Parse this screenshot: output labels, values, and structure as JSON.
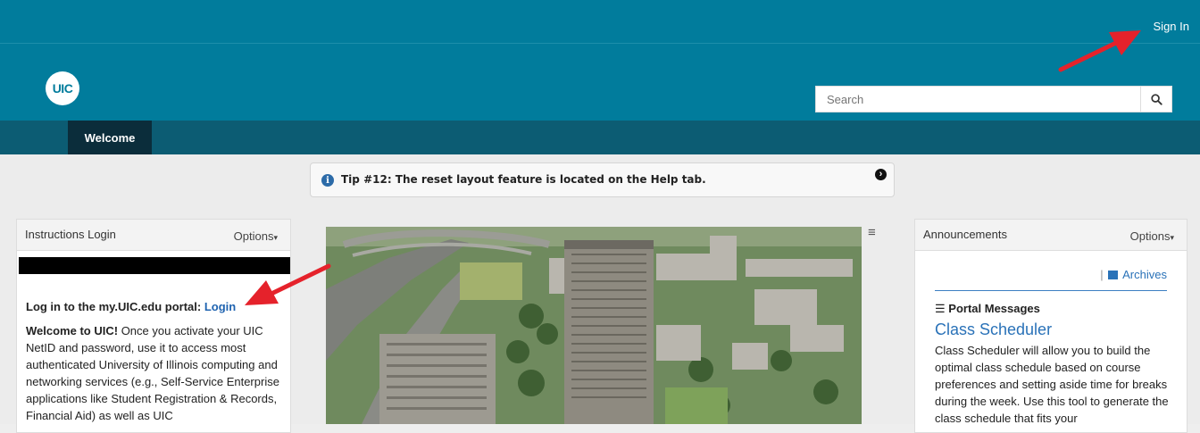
{
  "header": {
    "signin_label": "Sign In",
    "logo_text": "UIC",
    "search_placeholder": "Search"
  },
  "nav": {
    "tabs": [
      {
        "label": "Welcome",
        "active": true
      }
    ]
  },
  "tip": {
    "text": "Tip #12: The reset layout feature is located on the Help tab."
  },
  "instructions": {
    "title": "Instructions Login",
    "options_label": "Options",
    "login_prefix": "Log in to the my.UIC.edu portal:",
    "login_link": "Login",
    "welcome_bold": "Welcome to UIC!",
    "welcome_text": "Once you activate your UIC NetID and password, use it to access most authenticated University of Illinois computing and networking services (e.g., Self-Service Enterprise applications like Student Registration & Records, Financial Aid) as well as UIC"
  },
  "announcements": {
    "title": "Announcements",
    "options_label": "Options",
    "archives_label": "Archives",
    "portal_messages_label": "Portal Messages",
    "item_title": "Class Scheduler",
    "item_desc": "Class Scheduler will allow you to build the optimal class schedule based on course preferences and setting aside time for breaks during the week. Use this tool to generate the class schedule that fits your"
  },
  "colors": {
    "brand": "#017c9c",
    "nav": "#0c5c73",
    "active_tab": "#0b2d3b",
    "link": "#2a72b8",
    "annotation_arrow": "#e5222b"
  }
}
